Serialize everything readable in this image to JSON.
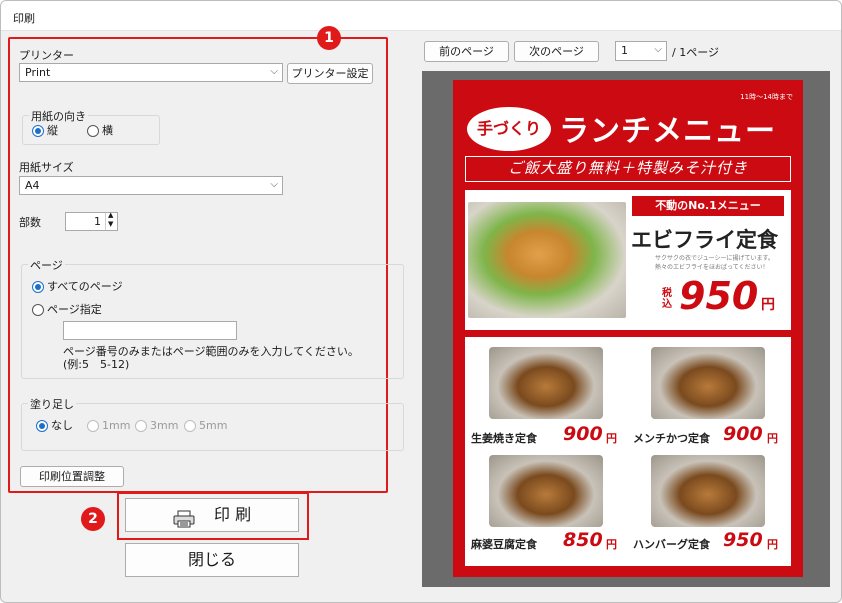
{
  "window": {
    "title": "印刷"
  },
  "badges": {
    "one": "1",
    "two": "2"
  },
  "printer": {
    "label": "プリンター",
    "value": "Print",
    "settings_button": "プリンター設定"
  },
  "orientation": {
    "caption": "用紙の向き",
    "portrait": "縦",
    "landscape": "横",
    "selected": "portrait"
  },
  "paper_size": {
    "label": "用紙サイズ",
    "value": "A4"
  },
  "copies": {
    "label": "部数",
    "value": "1"
  },
  "pages": {
    "caption": "ページ",
    "all": "すべてのページ",
    "range": "ページ指定",
    "range_value": "",
    "hint_line1": "ページ番号のみまたはページ範囲のみを入力してください。",
    "hint_line2": "(例:5　5-12)"
  },
  "bleed": {
    "caption": "塗り足し",
    "options": [
      "なし",
      "1mm",
      "3mm",
      "5mm"
    ],
    "selected": "なし"
  },
  "adjust_button": "印刷位置調整",
  "print_button": "印 刷",
  "close_button": "閉じる",
  "preview_nav": {
    "prev": "前のページ",
    "next": "次のページ",
    "page_value": "1",
    "page_total": "/ 1ページ"
  },
  "poster": {
    "hours": "11時～14時まで",
    "logo": "手づくり",
    "title": "ランチメニュー",
    "band": "ご飯大盛り無料＋特製みそ汁付き",
    "featured_tag": "不動のNo.1メニュー",
    "featured_name": "エビフライ定食",
    "featured_desc": "サクサクの衣でジューシーに揚げています。熱々のエビフライをほおばってください！",
    "tax_label": "税込",
    "featured_price": "950",
    "yen": "円",
    "items": [
      {
        "name": "生姜焼き定食",
        "price": "900"
      },
      {
        "name": "メンチかつ定食",
        "price": "900"
      },
      {
        "name": "麻婆豆腐定食",
        "price": "850"
      },
      {
        "name": "ハンバーグ定食",
        "price": "950"
      }
    ]
  },
  "colors": {
    "accent_red": "#e01a1a",
    "poster_red": "#cc0a12",
    "radio_blue": "#1a6fc9"
  }
}
